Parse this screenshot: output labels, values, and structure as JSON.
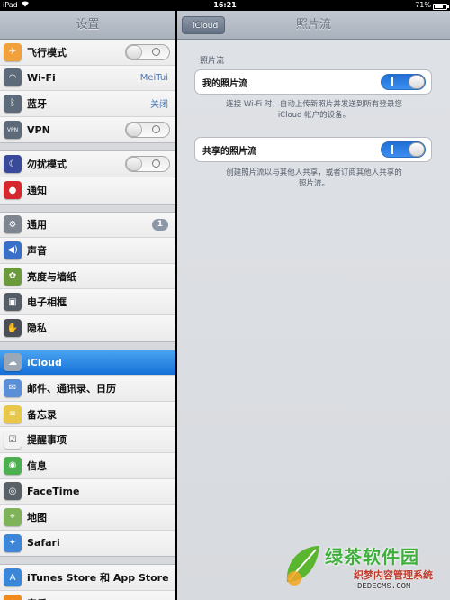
{
  "status_bar": {
    "device": "iPad",
    "time": "16:21",
    "battery_text": "71%",
    "battery_level": 0.71
  },
  "settings": {
    "title": "设置",
    "groups": [
      [
        {
          "label": "飞行模式",
          "icon": "airplane-icon",
          "color": "#f0a13c",
          "control": "switch-off"
        },
        {
          "label": "Wi-Fi",
          "icon": "wifi-icon",
          "color": "#5c6a7a",
          "value": "MeiTui"
        },
        {
          "label": "蓝牙",
          "icon": "bluetooth-icon",
          "color": "#5c6a7a",
          "value": "关闭"
        },
        {
          "label": "VPN",
          "icon": "vpn-icon",
          "color": "#5c6a7a",
          "control": "switch-off"
        }
      ],
      [
        {
          "label": "勿扰模式",
          "icon": "moon-icon",
          "color": "#3a4a9a",
          "control": "switch-off"
        },
        {
          "label": "通知",
          "icon": "notification-icon",
          "color": "#d6272f"
        }
      ],
      [
        {
          "label": "通用",
          "icon": "gear-icon",
          "color": "#7d8590",
          "badge": "1"
        },
        {
          "label": "声音",
          "icon": "speaker-icon",
          "color": "#3a6fc8"
        },
        {
          "label": "亮度与墙纸",
          "icon": "flower-icon",
          "color": "#6b9a3c"
        },
        {
          "label": "电子相框",
          "icon": "photo-frame-icon",
          "color": "#555d66"
        },
        {
          "label": "隐私",
          "icon": "hand-icon",
          "color": "#4a4f57"
        }
      ],
      [
        {
          "label": "iCloud",
          "icon": "cloud-icon",
          "color": "#9aa7b6",
          "selected": true
        },
        {
          "label": "邮件、通讯录、日历",
          "icon": "mail-icon",
          "color": "#5a8fd8"
        },
        {
          "label": "备忘录",
          "icon": "notes-icon",
          "color": "#e8c84a"
        },
        {
          "label": "提醒事项",
          "icon": "reminders-icon",
          "color": "#f2f2f2"
        },
        {
          "label": "信息",
          "icon": "messages-icon",
          "color": "#4caf50"
        },
        {
          "label": "FaceTime",
          "icon": "facetime-icon",
          "color": "#5a6068"
        },
        {
          "label": "地图",
          "icon": "map-icon",
          "color": "#7fb35a"
        },
        {
          "label": "Safari",
          "icon": "compass-icon",
          "color": "#3d86d8"
        }
      ],
      [
        {
          "label": "iTunes Store 和 App Store",
          "icon": "app-store-icon",
          "color": "#3a86d8"
        },
        {
          "label": "音乐",
          "icon": "music-icon",
          "color": "#f08a1c"
        }
      ]
    ]
  },
  "detail": {
    "back_label": "iCloud",
    "title": "照片流",
    "section_label": "照片流",
    "my_stream": {
      "label": "我的照片流",
      "on": true,
      "note_line1": "连接 Wi-Fi 时，自动上传新照片并发送到所有登录您",
      "note_line2": "iCloud 帐户的设备。"
    },
    "shared_stream": {
      "label": "共享的照片流",
      "on": true,
      "note_line1": "创建照片流以与其他人共享，或者订阅其他人共享的",
      "note_line2": "照片流。"
    }
  },
  "watermark": {
    "brand": "绿茶软件园",
    "line2": "织梦内容管理系统",
    "line3": "DEDECMS.COM"
  }
}
